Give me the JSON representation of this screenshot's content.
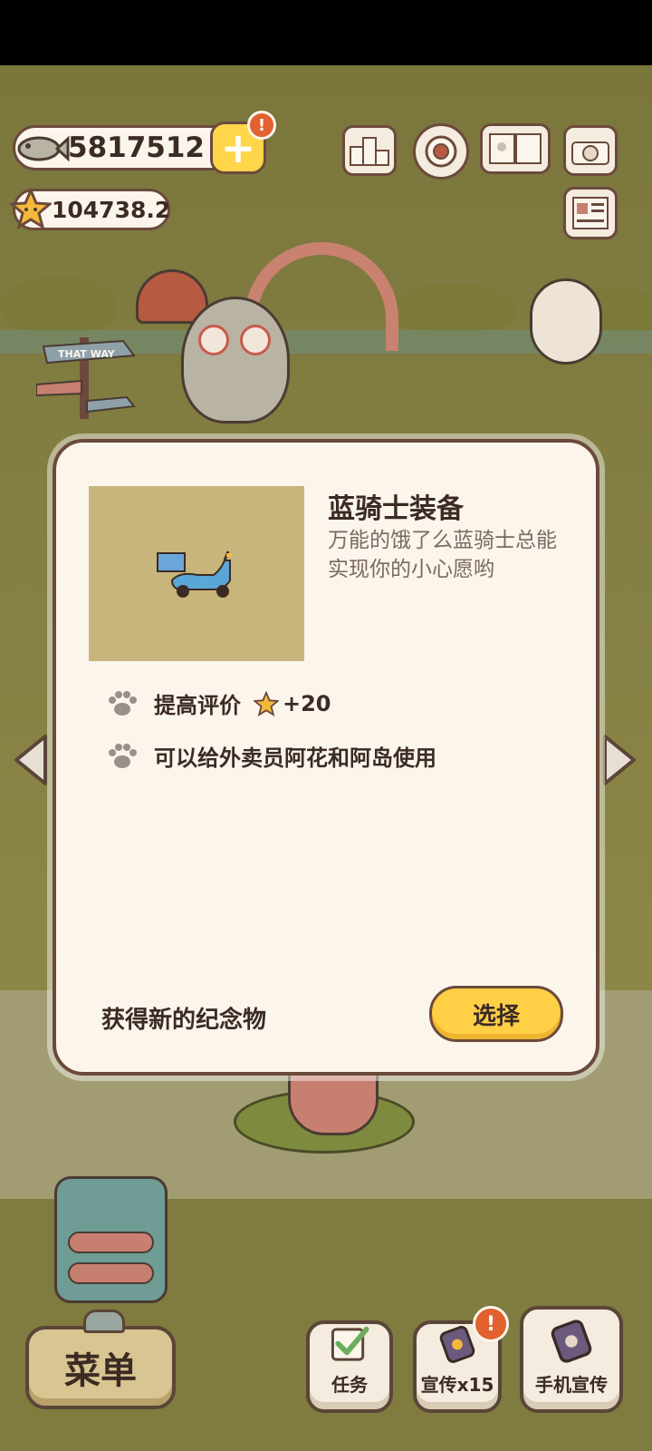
{
  "hud": {
    "fish_count": "5817512",
    "star_rating": "104738.2",
    "plus_badge": "!",
    "icons": [
      "ranking-icon",
      "settings-gear-icon",
      "album-book-icon",
      "camera-icon",
      "newspaper-icon"
    ]
  },
  "scene": {
    "signpost_text": "THAT WAY",
    "progress_fraction": 0.55
  },
  "modal": {
    "item_title": "蓝骑士装备",
    "item_desc": "万能的饿了么蓝骑士总能实现你的小心愿哟",
    "effects": [
      {
        "text": "提高评价",
        "bonus": "+20"
      },
      {
        "text": "可以给外卖员阿花和阿岛使用"
      }
    ],
    "obtained_label": "获得新的纪念物",
    "select_label": "选择"
  },
  "bottom": {
    "menu_label": "菜单",
    "task_label": "任务",
    "promo_label": "宣传x15",
    "promo_badge": "!",
    "phone_promo_label": "手机宣传"
  },
  "colors": {
    "accent_yellow": "#ffcf45",
    "panel_bg": "#fbf5ec",
    "outline_brown": "#6b4a3c",
    "badge_orange": "#e2612e"
  }
}
